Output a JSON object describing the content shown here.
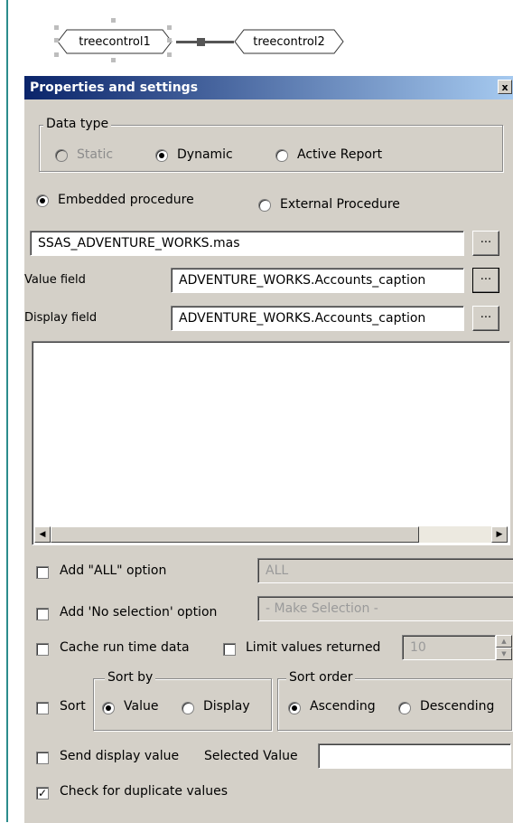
{
  "canvas": {
    "nodes": [
      "treecontrol1",
      "treecontrol2"
    ]
  },
  "panel": {
    "title": "Properties and settings",
    "close": "x",
    "data_type": {
      "legend": "Data type",
      "options": [
        "Static",
        "Dynamic",
        "Active Report"
      ],
      "selected": "Dynamic"
    },
    "procedure": {
      "options": [
        "Embedded procedure",
        "External Procedure"
      ],
      "selected": "Embedded procedure",
      "file": "SSAS_ADVENTURE_WORKS.mas"
    },
    "value_field": {
      "label": "Value field",
      "value": "ADVENTURE_WORKS.Accounts_caption"
    },
    "display_field": {
      "label": "Display field",
      "value": "ADVENTURE_WORKS.Accounts_caption"
    },
    "browse": "...",
    "add_all": {
      "label": "Add \"ALL\" option",
      "value": "ALL",
      "checked": false
    },
    "no_selection": {
      "label": "Add 'No selection' option",
      "value": "- Make Selection -",
      "checked": false
    },
    "cache": {
      "label": "Cache run time data",
      "checked": false
    },
    "limit": {
      "label": "Limit values returned",
      "value": "10",
      "checked": false
    },
    "sort": {
      "label": "Sort",
      "sort_by": {
        "legend": "Sort by",
        "options": [
          "Value",
          "Display"
        ],
        "selected": "Value"
      },
      "sort_order": {
        "legend": "Sort order",
        "options": [
          "Ascending",
          "Descending"
        ],
        "selected": "Ascending"
      }
    },
    "send_display": {
      "label": "Send display value",
      "checked": false
    },
    "selected_value": {
      "label": "Selected Value",
      "value": ""
    },
    "dup_check": {
      "label": "Check for duplicate values",
      "checked": true
    }
  }
}
